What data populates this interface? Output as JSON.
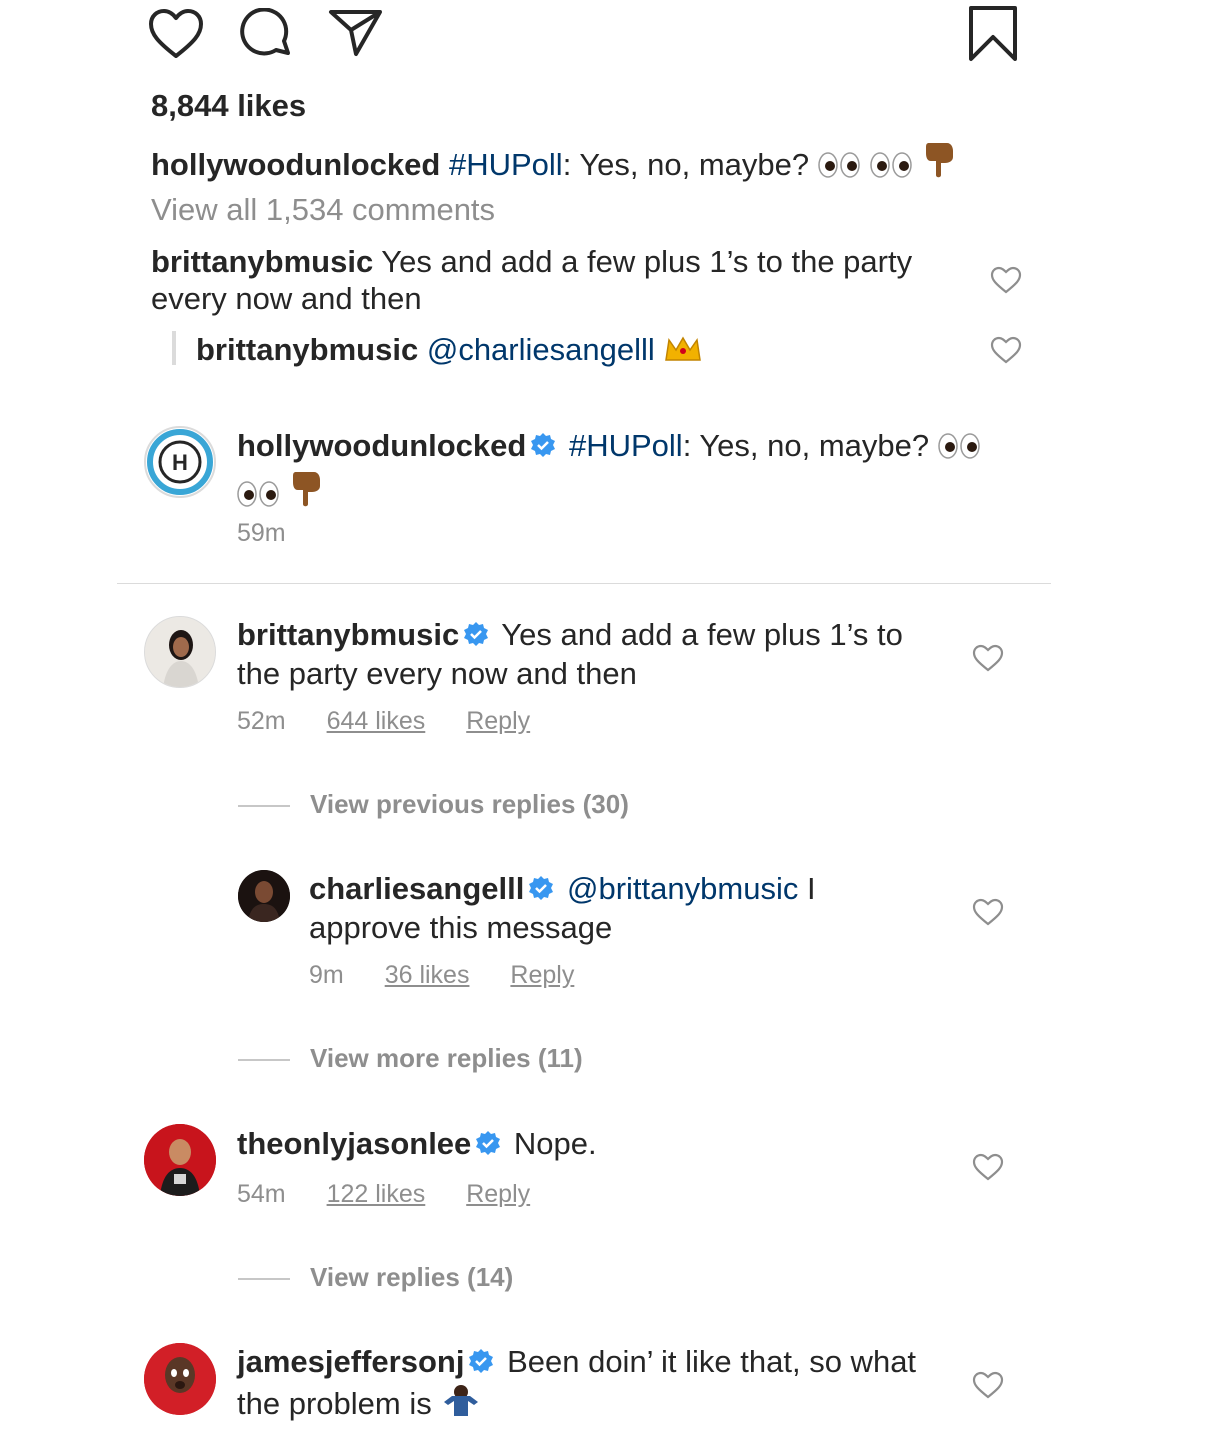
{
  "post": {
    "likes_text": "8,844 likes",
    "caption_user": "hollywoodunlocked",
    "caption_hashtag": "#HUPoll",
    "caption_text": ": Yes, no, maybe?",
    "view_all": "View all 1,534 comments",
    "preview_comments": [
      {
        "user": "brittanybmusic",
        "text": "Yes and add a few plus 1’s to the party every now and then"
      },
      {
        "user": "brittanybmusic",
        "mention": "@charliesangelll"
      }
    ]
  },
  "caption_block": {
    "user": "hollywoodunlocked",
    "hashtag": "#HUPoll",
    "text": ": Yes, no, maybe?",
    "time": "59m"
  },
  "comments": [
    {
      "user": "brittanybmusic",
      "text": "Yes and add a few plus 1’s to the party every now and then",
      "time": "52m",
      "likes": "644 likes",
      "reply": "Reply",
      "view_previous": "View previous replies (30)",
      "view_more": "View more replies (11)"
    },
    {
      "user": "charliesangelll",
      "mention": "@brittanybmusic",
      "text": " I approve this message",
      "time": "9m",
      "likes": "36 likes",
      "reply": "Reply"
    },
    {
      "user": "theonlyjasonlee",
      "text": "Nope.",
      "time": "54m",
      "likes": "122 likes",
      "reply": "Reply",
      "view_replies": "View replies (14)"
    },
    {
      "user": "jamesjeffersonj",
      "text": "Been doin’ it like that, so what the problem is"
    }
  ],
  "colors": {
    "text": "#262626",
    "link": "#00376b",
    "verified": "#3897f0",
    "grey": "#8e8e8e"
  },
  "icons": [
    "heart-icon",
    "comment-icon",
    "share-icon",
    "bookmark-icon",
    "verified-icon",
    "eyes-emoji",
    "point-down-emoji",
    "crown-emoji",
    "shrug-emoji"
  ]
}
